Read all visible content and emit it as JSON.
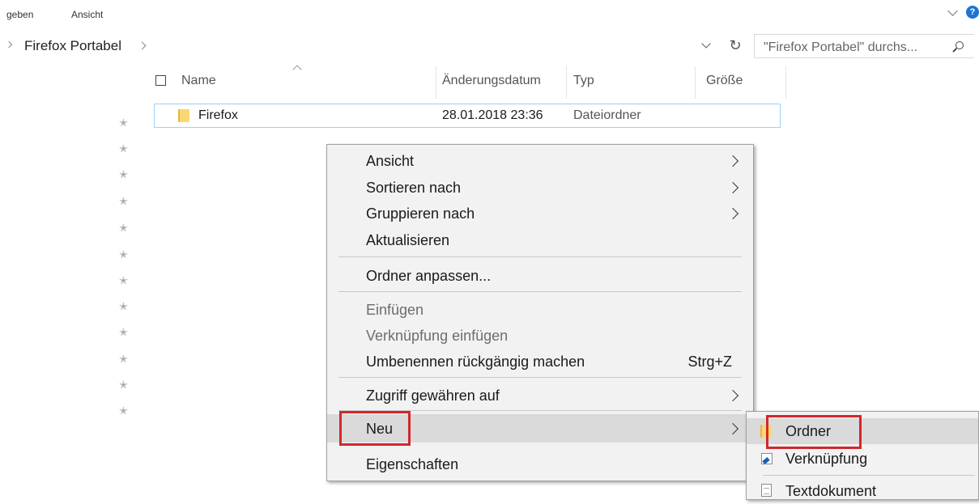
{
  "ribbon": {
    "tabs": [
      "geben",
      "Ansicht"
    ],
    "help_label": "?"
  },
  "address": {
    "breadcrumb": "Firefox Portabel",
    "search_placeholder": "\"Firefox Portabel\" durchs...",
    "refresh_glyph": "↻"
  },
  "columns": {
    "name": "Name",
    "date": "Änderungsdatum",
    "type": "Typ",
    "size": "Größe"
  },
  "files": [
    {
      "name": "Firefox",
      "date": "28.01.2018 23:36",
      "type": "Dateiordner",
      "size": ""
    }
  ],
  "pin_glyph": "✭",
  "context_menu": {
    "items": [
      {
        "label": "Ansicht",
        "submenu": true,
        "enabled": true
      },
      {
        "label": "Sortieren nach",
        "submenu": true,
        "enabled": true
      },
      {
        "label": "Gruppieren nach",
        "submenu": true,
        "enabled": true
      },
      {
        "label": "Aktualisieren",
        "submenu": false,
        "enabled": true
      },
      {
        "label": "Ordner anpassen...",
        "submenu": false,
        "enabled": true
      },
      {
        "label": "Einfügen",
        "submenu": false,
        "enabled": false
      },
      {
        "label": "Verknüpfung einfügen",
        "submenu": false,
        "enabled": false
      },
      {
        "label": "Umbenennen rückgängig machen",
        "shortcut": "Strg+Z",
        "submenu": false,
        "enabled": true
      },
      {
        "label": "Zugriff gewähren auf",
        "submenu": true,
        "enabled": true
      },
      {
        "label": "Neu",
        "submenu": true,
        "enabled": true,
        "highlighted": true
      },
      {
        "label": "Eigenschaften",
        "submenu": false,
        "enabled": true
      }
    ]
  },
  "new_submenu": {
    "items": [
      {
        "label": "Ordner",
        "icon": "folder-icon",
        "highlighted": true
      },
      {
        "label": "Verknüpfung",
        "icon": "shortcut-icon"
      },
      {
        "label": "Textdokument",
        "icon": "text-document-icon"
      }
    ]
  },
  "colors": {
    "highlight_box": "#d4272b",
    "selection_border": "#99d1ff",
    "menu_bg": "#f2f2f2"
  }
}
